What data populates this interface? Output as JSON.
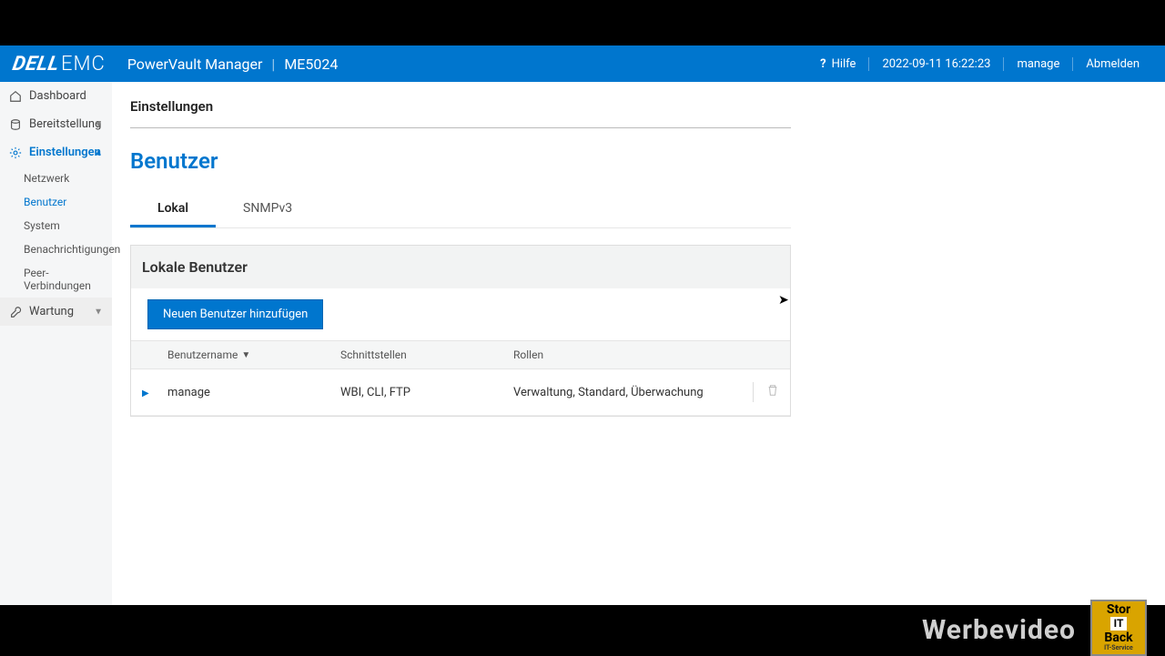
{
  "header": {
    "logo_dell": "DELL",
    "logo_emc": "EMC",
    "app_name": "PowerVault Manager",
    "model": "ME5024",
    "help_label": "Hilfe",
    "timestamp": "2022-09-11 16:22:23",
    "user": "manage",
    "logout": "Abmelden"
  },
  "sidebar": {
    "dashboard": "Dashboard",
    "bereitstellung": "Bereitstellung",
    "einstellungen": "Einstellungen",
    "sub": {
      "netzwerk": "Netzwerk",
      "benutzer": "Benutzer",
      "system": "System",
      "benachrichtigungen": "Benachrichtigungen",
      "peer": "Peer-Verbindungen"
    },
    "wartung": "Wartung"
  },
  "main": {
    "crumb": "Einstellungen",
    "h1": "Benutzer",
    "tabs": {
      "lokal": "Lokal",
      "snmp": "SNMPv3"
    },
    "panel_title": "Lokale Benutzer",
    "add_button": "Neuen Benutzer hinzufügen",
    "columns": {
      "user": "Benutzername",
      "interfaces": "Schnittstellen",
      "roles": "Rollen"
    },
    "rows": [
      {
        "user": "manage",
        "interfaces": "WBI, CLI, FTP",
        "roles": "Verwaltung, Standard, Überwachung"
      }
    ]
  },
  "overlay": {
    "text": "Werbevideo",
    "badge": {
      "l1": "Stor",
      "l2": "IT",
      "l3": "Back",
      "l4": "IT-Service"
    }
  }
}
